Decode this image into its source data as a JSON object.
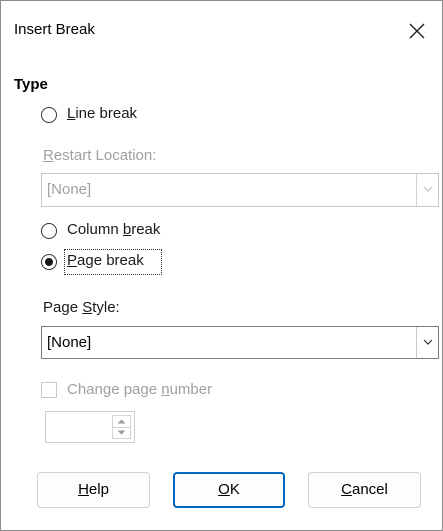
{
  "dialog": {
    "title": "Insert Break",
    "close_icon": "close-icon"
  },
  "type_section": {
    "label": "Type",
    "options": [
      {
        "label_parts": [
          "",
          "L",
          "ine break"
        ],
        "selected": false
      },
      {
        "label_parts": [
          "Column ",
          "b",
          "reak"
        ],
        "selected": false
      },
      {
        "label_parts": [
          "",
          "P",
          "age break"
        ],
        "selected": true
      }
    ]
  },
  "restart_location": {
    "label_parts": [
      "",
      "R",
      "estart Location:"
    ],
    "value": "[None]",
    "enabled": false
  },
  "page_style": {
    "label_parts": [
      "Page ",
      "S",
      "tyle:"
    ],
    "value": "[None]",
    "enabled": true
  },
  "change_page_number": {
    "label_parts": [
      "Change page ",
      "n",
      "umber"
    ],
    "checked": false,
    "enabled": false,
    "value": ""
  },
  "buttons": {
    "help": {
      "label_parts": [
        "",
        "H",
        "elp"
      ]
    },
    "ok": {
      "label_parts": [
        "",
        "O",
        "K"
      ]
    },
    "cancel": {
      "label_parts": [
        "",
        "C",
        "ancel"
      ]
    }
  },
  "colors": {
    "accent": "#0067c0",
    "disabled_text": "#a0a0a0",
    "border": "#8c8c8c"
  }
}
